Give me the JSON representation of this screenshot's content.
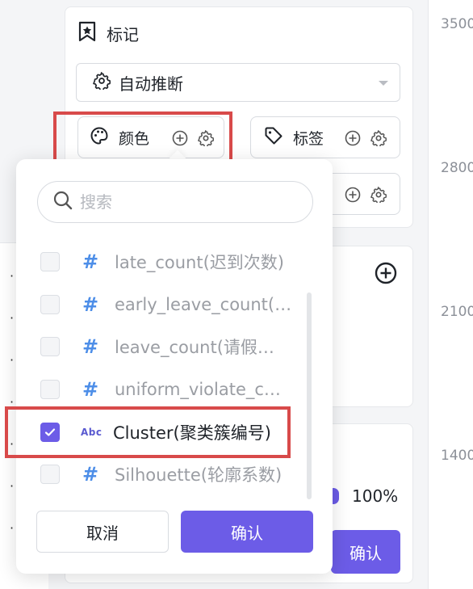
{
  "axis": {
    "labels": [
      "3500",
      "2800",
      "2100",
      "1400"
    ]
  },
  "marks": {
    "title": "标记",
    "type_select": {
      "value": "自动推断"
    },
    "channels": [
      {
        "label": "颜色"
      },
      {
        "label": "标签"
      }
    ]
  },
  "background": {
    "percent": "100%",
    "confirm_label": "确认"
  },
  "popup": {
    "search_placeholder": "搜索",
    "fields": [
      {
        "type": "#",
        "name": "late_count(迟到次数)",
        "checked": false
      },
      {
        "type": "#",
        "name": "early_leave_count(…",
        "checked": false
      },
      {
        "type": "#",
        "name": "leave_count(请假…",
        "checked": false
      },
      {
        "type": "#",
        "name": "uniform_violate_c…",
        "checked": false
      },
      {
        "type": "Abc",
        "name": "Cluster(聚类簇编号)",
        "checked": true
      },
      {
        "type": "#",
        "name": "Silhouette(轮廓系数)",
        "checked": false
      }
    ],
    "cancel_label": "取消",
    "confirm_label": "确认"
  },
  "colors": {
    "accent": "#6c5ce7",
    "highlight": "#d84a4a",
    "number_type": "#4d8ee8"
  }
}
